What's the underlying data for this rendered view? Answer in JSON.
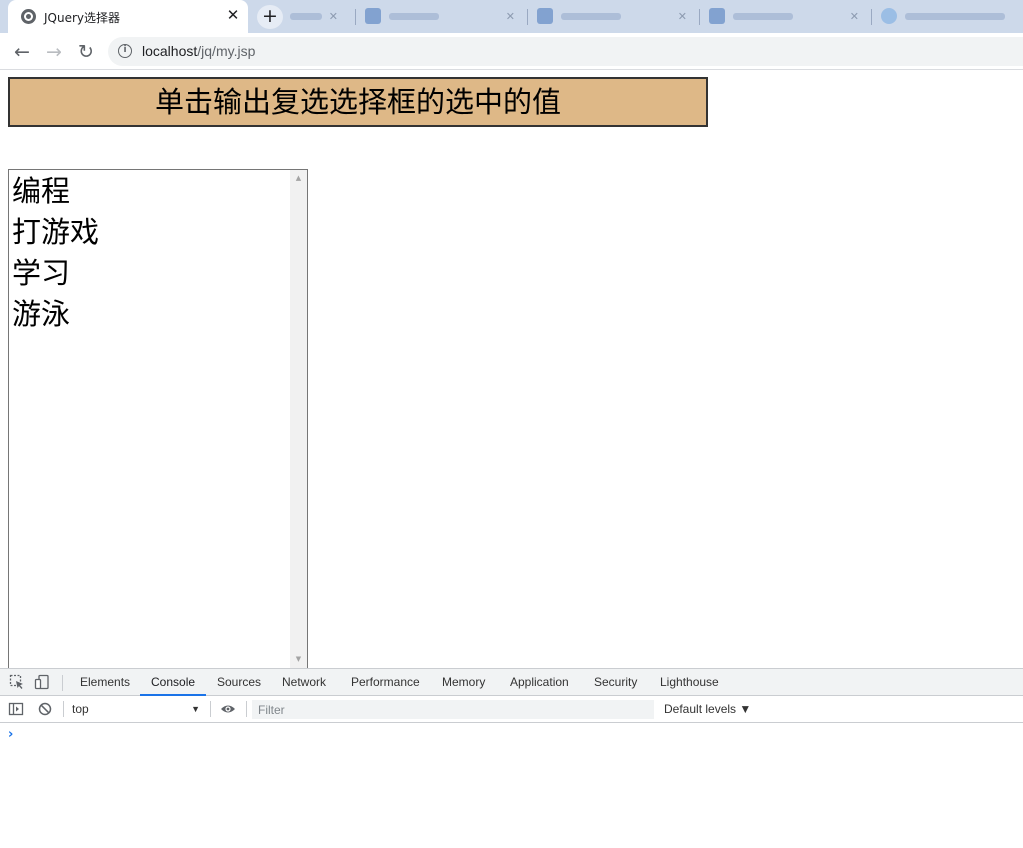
{
  "browser": {
    "active_tab": {
      "title": "JQuery选择器",
      "close_glyph": "✕",
      "favicon": "globe-icon"
    },
    "new_tab_glyph": "+",
    "address": {
      "host": "localhost",
      "path": "/jq/my.jsp"
    },
    "nav": {
      "back": "←",
      "forward": "→",
      "reload": "↻"
    }
  },
  "page": {
    "button_label": "单击输出复选选择框的选中的值",
    "button_color": "#deb887",
    "options": [
      "编程",
      "打游戏",
      "学习",
      "游泳"
    ]
  },
  "devtools": {
    "tabs": [
      "Elements",
      "Console",
      "Sources",
      "Network",
      "Performance",
      "Memory",
      "Application",
      "Security",
      "Lighthouse"
    ],
    "active_tab": "Console",
    "context": "top",
    "filter_placeholder": "Filter",
    "levels": "Default levels ▼",
    "prompt": "›",
    "accent_color": "#1a73e8"
  }
}
